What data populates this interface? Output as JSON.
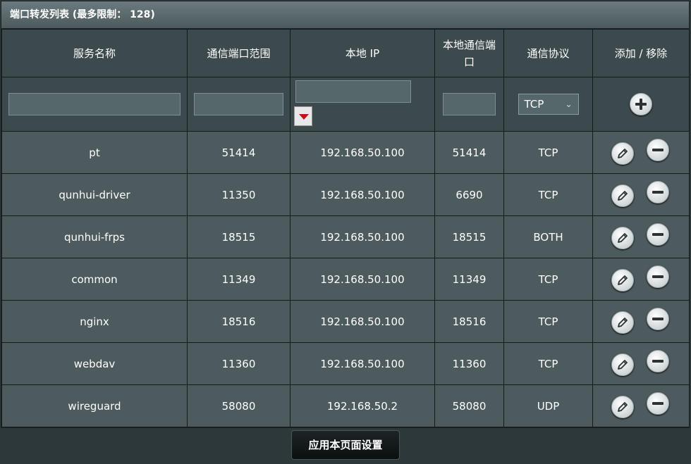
{
  "title": "端口转发列表 (最多限制： 128)",
  "columns": [
    "服务名称",
    "通信端口范围",
    "本地 IP",
    "本地通信端口",
    "通信协议",
    "添加 / 移除"
  ],
  "input_row": {
    "protocol_selected": "TCP",
    "protocol_chevron": "chevron-down-icon"
  },
  "rows": [
    {
      "name": "pt",
      "port_range": "51414",
      "local_ip": "192.168.50.100",
      "local_port": "51414",
      "protocol": "TCP"
    },
    {
      "name": "qunhui-driver",
      "port_range": "11350",
      "local_ip": "192.168.50.100",
      "local_port": "6690",
      "protocol": "TCP"
    },
    {
      "name": "qunhui-frps",
      "port_range": "18515",
      "local_ip": "192.168.50.100",
      "local_port": "18515",
      "protocol": "BOTH"
    },
    {
      "name": "common",
      "port_range": "11349",
      "local_ip": "192.168.50.100",
      "local_port": "11349",
      "protocol": "TCP"
    },
    {
      "name": "nginx",
      "port_range": "18516",
      "local_ip": "192.168.50.100",
      "local_port": "18516",
      "protocol": "TCP"
    },
    {
      "name": "webdav",
      "port_range": "11360",
      "local_ip": "192.168.50.100",
      "local_port": "11360",
      "protocol": "TCP"
    },
    {
      "name": "wireguard",
      "port_range": "58080",
      "local_ip": "192.168.50.2",
      "local_port": "58080",
      "protocol": "UDP"
    }
  ],
  "apply_button": "应用本页面设置",
  "colors": {
    "background": "#2d383a",
    "row": "#4d5b5f",
    "header": "#3d4a4d",
    "drop_arrow": "#c0141a"
  }
}
